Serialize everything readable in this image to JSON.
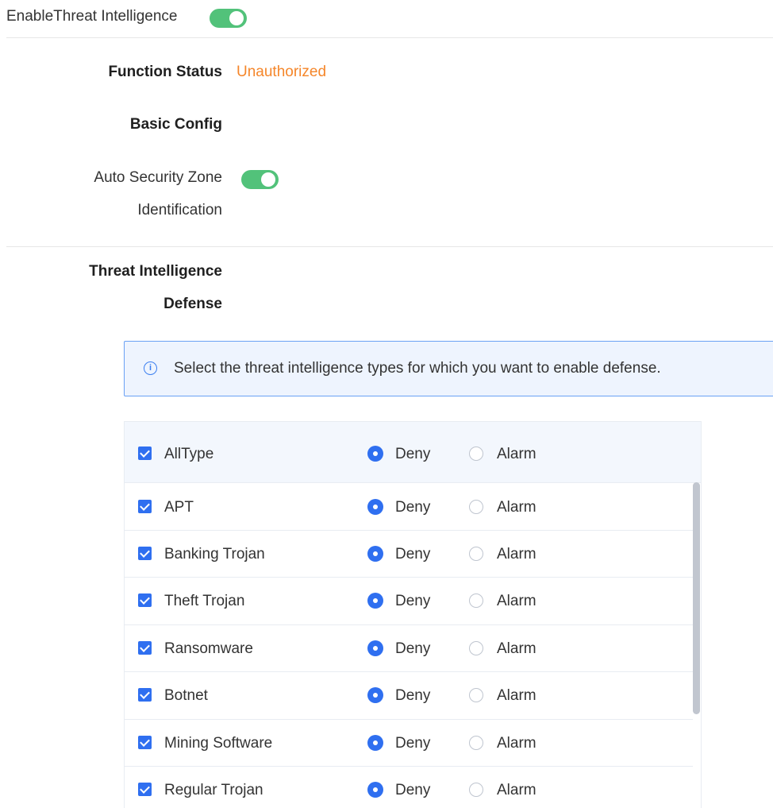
{
  "top": {
    "enable_label": "EnableThreat Intelligence",
    "enable_toggle_on": true
  },
  "function_status": {
    "label": "Function Status",
    "value": "Unauthorized",
    "value_color": "#f5862a"
  },
  "basic_config": {
    "heading": "Basic Config"
  },
  "auto_zone": {
    "label_line1": "Auto Security Zone",
    "label_line2": "Identification",
    "toggle_on": true
  },
  "defense": {
    "label_line1": "Threat Intelligence",
    "label_line2": "Defense"
  },
  "info": {
    "text": "Select the threat intelligence types for which you want to enable defense.",
    "icon": "info-circle-icon",
    "icon_glyph": "i"
  },
  "table": {
    "header": {
      "name": "AllType",
      "deny": "Deny",
      "alarm": "Alarm",
      "checked": true,
      "selected": "Deny"
    },
    "rows": [
      {
        "name": "APT",
        "deny": "Deny",
        "alarm": "Alarm",
        "checked": true,
        "selected": "Deny"
      },
      {
        "name": "Banking Trojan",
        "deny": "Deny",
        "alarm": "Alarm",
        "checked": true,
        "selected": "Deny"
      },
      {
        "name": "Theft Trojan",
        "deny": "Deny",
        "alarm": "Alarm",
        "checked": true,
        "selected": "Deny"
      },
      {
        "name": "Ransomware",
        "deny": "Deny",
        "alarm": "Alarm",
        "checked": true,
        "selected": "Deny"
      },
      {
        "name": "Botnet",
        "deny": "Deny",
        "alarm": "Alarm",
        "checked": true,
        "selected": "Deny"
      },
      {
        "name": "Mining Software",
        "deny": "Deny",
        "alarm": "Alarm",
        "checked": true,
        "selected": "Deny"
      },
      {
        "name": "Regular Trojan",
        "deny": "Deny",
        "alarm": "Alarm",
        "checked": true,
        "selected": "Deny"
      }
    ]
  },
  "colors": {
    "accent": "#2f6ff0",
    "toggle_on": "#52c27a",
    "warning": "#f5862a"
  }
}
